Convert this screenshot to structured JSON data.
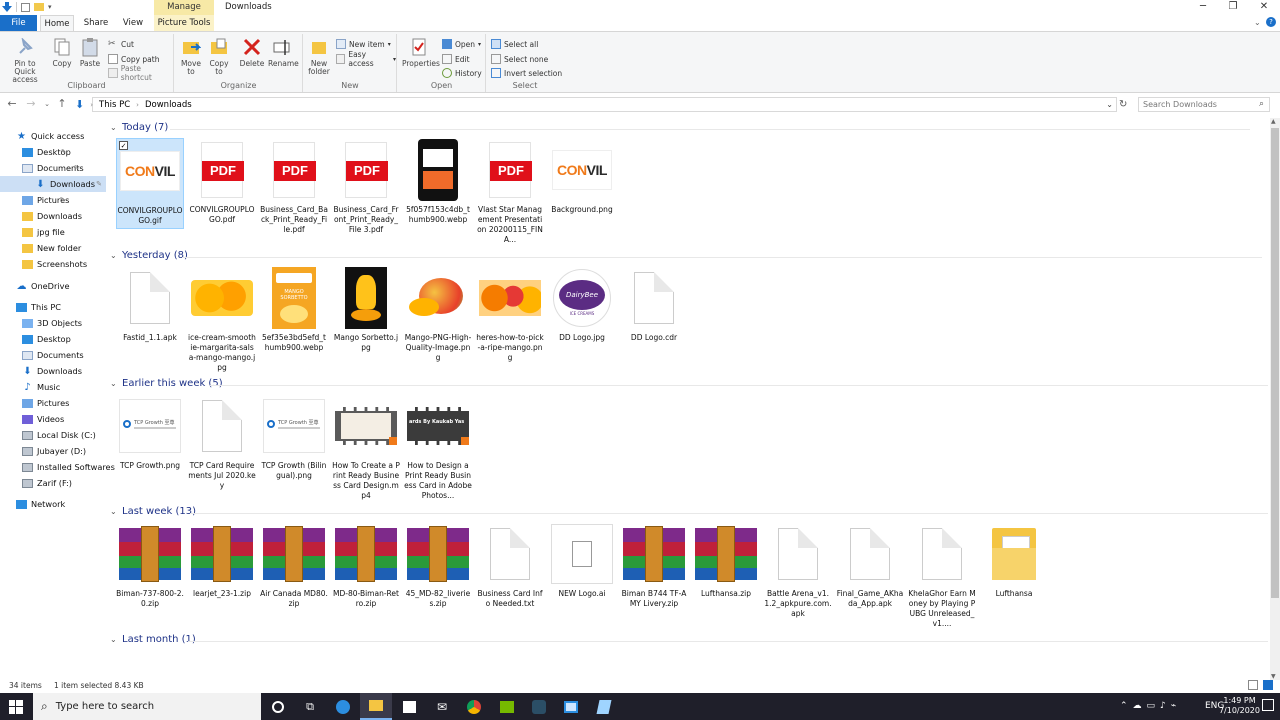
{
  "window": {
    "title": "Downloads",
    "manage_tab": "Manage"
  },
  "ribbon_tabs": [
    "File",
    "Home",
    "Share",
    "View",
    "Picture Tools"
  ],
  "ribbon": {
    "clipboard": {
      "label": "Clipboard",
      "pin": "Pin to Quick access",
      "copy": "Copy",
      "paste": "Paste",
      "cut": "Cut",
      "copy_path": "Copy path",
      "paste_shortcut": "Paste shortcut"
    },
    "organize": {
      "label": "Organize",
      "move_to": "Move to",
      "copy_to": "Copy to",
      "delete": "Delete",
      "rename": "Rename"
    },
    "new": {
      "label": "New",
      "new_folder": "New folder",
      "new_item": "New item",
      "easy_access": "Easy access"
    },
    "open": {
      "label": "Open",
      "properties": "Properties",
      "open": "Open",
      "edit": "Edit",
      "history": "History"
    },
    "select": {
      "label": "Select",
      "select_all": "Select all",
      "select_none": "Select none",
      "invert": "Invert selection"
    }
  },
  "address": {
    "crumbs": [
      "This PC",
      "Downloads"
    ],
    "search_placeholder": "Search Downloads"
  },
  "sidebar": [
    {
      "label": "Quick access",
      "icon": "star-icon",
      "level": 0
    },
    {
      "label": "Desktop",
      "icon": "desktop-icon",
      "level": 1,
      "pinned": true
    },
    {
      "label": "Documents",
      "icon": "documents-icon",
      "level": 1,
      "pinned": true
    },
    {
      "label": "Downloads",
      "icon": "download-icon",
      "level": 1,
      "pinned": true,
      "selected": true
    },
    {
      "label": "Pictures",
      "icon": "pictures-icon",
      "level": 1,
      "pinned": true
    },
    {
      "label": "Downloads",
      "icon": "folder-icon",
      "level": 1
    },
    {
      "label": "jpg file",
      "icon": "folder-icon",
      "level": 1
    },
    {
      "label": "New folder",
      "icon": "folder-icon",
      "level": 1
    },
    {
      "label": "Screenshots",
      "icon": "folder-icon",
      "level": 1
    },
    {
      "label": "OneDrive",
      "icon": "cloud-icon",
      "level": 0
    },
    {
      "label": "This PC",
      "icon": "pc-icon",
      "level": 0
    },
    {
      "label": "3D Objects",
      "icon": "3d-objects-icon",
      "level": 1
    },
    {
      "label": "Desktop",
      "icon": "desktop-icon",
      "level": 1
    },
    {
      "label": "Documents",
      "icon": "documents-icon",
      "level": 1
    },
    {
      "label": "Downloads",
      "icon": "download-icon",
      "level": 1
    },
    {
      "label": "Music",
      "icon": "music-icon",
      "level": 1
    },
    {
      "label": "Pictures",
      "icon": "pictures-icon",
      "level": 1
    },
    {
      "label": "Videos",
      "icon": "videos-icon",
      "level": 1
    },
    {
      "label": "Local Disk (C:)",
      "icon": "drive-icon",
      "level": 1
    },
    {
      "label": "Jubayer (D:)",
      "icon": "drive-icon",
      "level": 1
    },
    {
      "label": "Installed Softwares",
      "icon": "drive-icon",
      "level": 1
    },
    {
      "label": "Zarif (F:)",
      "icon": "drive-icon",
      "level": 1
    },
    {
      "label": "Network",
      "icon": "network-icon",
      "level": 0
    }
  ],
  "groups": [
    {
      "label": "Today (7)",
      "items": [
        {
          "name": "CONVILGROUPLOGO.gif",
          "kind": "convil",
          "selected": true
        },
        {
          "name": "CONVILGROUPLOGO.pdf",
          "kind": "pdf"
        },
        {
          "name": "Business_Card_Back_Print_Ready_File.pdf",
          "kind": "pdf"
        },
        {
          "name": "Business_Card_Front_Print_Ready_File 3.pdf",
          "kind": "pdf"
        },
        {
          "name": "5f057f153c4db_thumb900.webp",
          "kind": "phone"
        },
        {
          "name": "Vlast Star Management Presentation 20200115_FINA...",
          "kind": "pdf"
        },
        {
          "name": "Background.png",
          "kind": "convil"
        }
      ]
    },
    {
      "label": "Yesterday (8)",
      "items": [
        {
          "name": "Fastid_1.1.apk",
          "kind": "doc"
        },
        {
          "name": "ice-cream-smoothie-margarita-salsa-mango-mango.jpg",
          "kind": "mango-cubes"
        },
        {
          "name": "5ef35e3bd5efd_thumb900.webp",
          "kind": "sorbetto-box"
        },
        {
          "name": "Mango Sorbetto.jpg",
          "kind": "mango-sorbetto"
        },
        {
          "name": "Mango-PNG-High-Quality-Image.png",
          "kind": "mango"
        },
        {
          "name": "heres-how-to-pick-a-ripe-mango.png",
          "kind": "mangoes"
        },
        {
          "name": "DD Logo.jpg",
          "kind": "dd-logo"
        },
        {
          "name": "DD Logo.cdr",
          "kind": "doc"
        }
      ]
    },
    {
      "label": "Earlier this week (5)",
      "items": [
        {
          "name": "TCP Growth.png",
          "kind": "tcp"
        },
        {
          "name": "TCP Card Requirements Jul 2020.key",
          "kind": "doc"
        },
        {
          "name": "TCP Growth (Bilingual).png",
          "kind": "tcp"
        },
        {
          "name": "How To Create a Print Ready Business Card Design.mp4",
          "kind": "video-light"
        },
        {
          "name": "How to Design a Print Ready Business Card in Adobe Photos...",
          "kind": "video-dark"
        }
      ]
    },
    {
      "label": "Last week (13)",
      "items": [
        {
          "name": "Biman-737-800-2.0.zip",
          "kind": "rar"
        },
        {
          "name": "learjet_23-1.zip",
          "kind": "rar"
        },
        {
          "name": "Air Canada MD80.zip",
          "kind": "rar"
        },
        {
          "name": "MD-80-Biman-Retro.zip",
          "kind": "rar"
        },
        {
          "name": "45_MD-82_liveries.zip",
          "kind": "rar"
        },
        {
          "name": "Business Card Info Needed.txt",
          "kind": "doc"
        },
        {
          "name": "NEW Logo.ai",
          "kind": "doc-small"
        },
        {
          "name": "Biman B744 TF-AMY Livery.zip",
          "kind": "rar"
        },
        {
          "name": "Lufthansa.zip",
          "kind": "rar"
        },
        {
          "name": "Battle Arena_v1.1.2_apkpure.com.apk",
          "kind": "doc"
        },
        {
          "name": "Final_Game_AKhada_App.apk",
          "kind": "doc"
        },
        {
          "name": "KhelaGhor Earn Money by Playing PUBG Unreleased_v1....",
          "kind": "doc"
        },
        {
          "name": "Lufthansa",
          "kind": "folder"
        }
      ]
    },
    {
      "label": "Last month (1)",
      "items": [
        {
          "name": "",
          "kind": "folder-partial"
        }
      ]
    }
  ],
  "thumb_text": {
    "convil_orange": "CON",
    "convil_dark": "VIL",
    "pdf": "PDF",
    "sorbetto": "MANGO SORBETTO",
    "dd": "DairyBee",
    "dd_sub": "ICE CREAMS",
    "tcp": "TCP Growth 至尊",
    "video_dark": "ards By Kaukab Yas"
  },
  "status": {
    "count": "34 items",
    "selection": "1 item selected  8.43 KB"
  },
  "taskbar": {
    "search_placeholder": "Type here to search",
    "time": "1:49 PM",
    "date": "7/10/2020"
  },
  "colors": {
    "accent": "#1a6fc9",
    "group_header": "#1e3287",
    "selection": "#cce5fb",
    "pdf_red": "#e0101a",
    "convil_orange": "#f07a1a"
  }
}
